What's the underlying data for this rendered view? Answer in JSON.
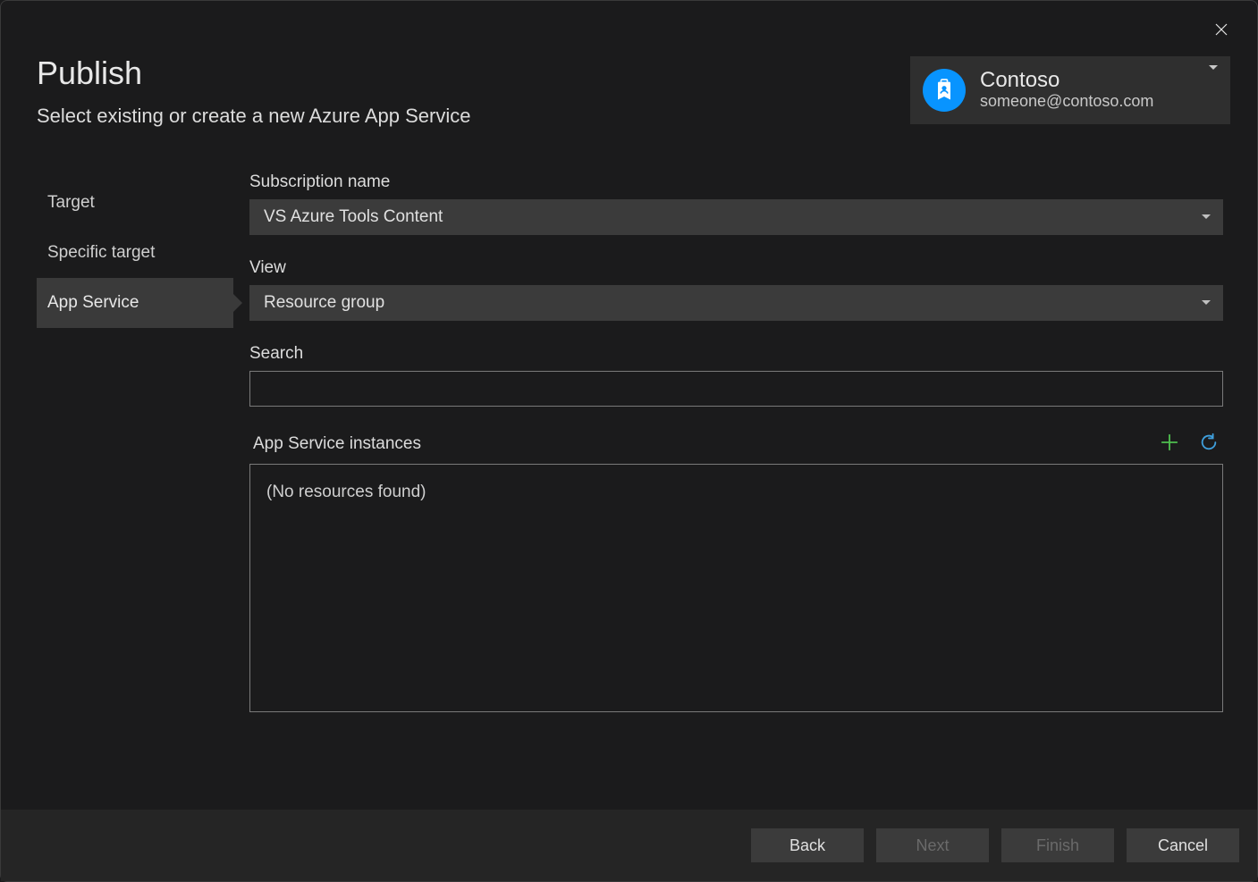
{
  "header": {
    "title": "Publish",
    "subtitle": "Select existing or create a new Azure App Service"
  },
  "account": {
    "name": "Contoso",
    "email": "someone@contoso.com"
  },
  "sidebar": {
    "items": [
      {
        "label": "Target"
      },
      {
        "label": "Specific target"
      },
      {
        "label": "App Service"
      }
    ],
    "active_index": 2
  },
  "fields": {
    "subscription": {
      "label": "Subscription name",
      "value": "VS Azure Tools Content"
    },
    "view": {
      "label": "View",
      "value": "Resource group"
    },
    "search": {
      "label": "Search",
      "value": ""
    },
    "instances": {
      "label": "App Service instances",
      "empty_text": "(No resources found)"
    }
  },
  "footer": {
    "back": "Back",
    "next": "Next",
    "finish": "Finish",
    "cancel": "Cancel"
  }
}
